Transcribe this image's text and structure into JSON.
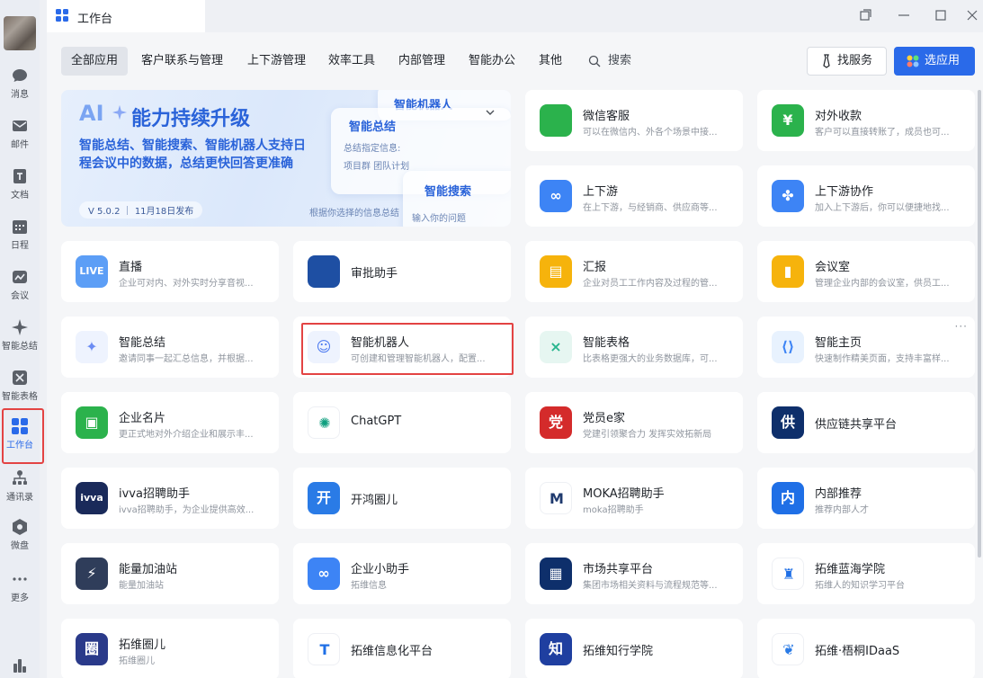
{
  "window": {
    "title": "工作台"
  },
  "sidebar": {
    "items": [
      {
        "label": "消息",
        "icon": "message-icon"
      },
      {
        "label": "邮件",
        "icon": "mail-icon"
      },
      {
        "label": "文档",
        "icon": "document-icon"
      },
      {
        "label": "日程",
        "icon": "calendar-icon"
      },
      {
        "label": "会议",
        "icon": "meeting-icon"
      },
      {
        "label": "智能总结",
        "icon": "sparkle-icon"
      },
      {
        "label": "智能表格",
        "icon": "smart-table-icon"
      },
      {
        "label": "工作台",
        "icon": "workbench-grid-icon",
        "active": true
      },
      {
        "label": "通讯录",
        "icon": "contacts-icon"
      },
      {
        "label": "微盘",
        "icon": "drive-icon"
      },
      {
        "label": "更多",
        "icon": "more-dots-icon"
      }
    ]
  },
  "tabs": [
    "全部应用",
    "客户联系与管理",
    "上下游管理",
    "效率工具",
    "内部管理",
    "智能办公",
    "其他"
  ],
  "search": {
    "label": "搜索"
  },
  "actions": {
    "find_service": "找服务",
    "pick_apps": "选应用"
  },
  "banner": {
    "ai": "AI",
    "title": "能力持续升级",
    "desc": "智能总结、智能搜索、智能机器人支持日程会议中的数据，总结更快回答更准确",
    "version": "V 5.0.2 ｜ 11月18日发布",
    "card1": "智能机器人",
    "card2": "智能总结",
    "card2_sub": "总结指定信息:",
    "card2_chips": "项目群    团队计划",
    "card2_hint": "根据你选择的信息总结",
    "card3": "智能搜索",
    "card3_input": "输入你的问题"
  },
  "apps": [
    {
      "name": "微信客服",
      "desc": "可以在微信内、外各个场景中接...",
      "icon": "wechat-service-icon",
      "color": "#2bb24c"
    },
    {
      "name": "对外收款",
      "desc": "客户可以直接转账了，成员也可...",
      "icon": "payment-icon",
      "color": "#2bb24c"
    },
    {
      "name": "上下游",
      "desc": "在上下游，与经销商、供应商等...",
      "icon": "chain-link-icon",
      "color": "#3d84f5"
    },
    {
      "name": "上下游协作",
      "desc": "加入上下游后，你可以便捷地找...",
      "icon": "grid-petal-icon",
      "color": "#3d84f5"
    },
    {
      "name": "直播",
      "desc": "企业可对内、对外实时分享音视...",
      "icon": "live-icon",
      "color": "#5c9ef6"
    },
    {
      "name": "审批助手",
      "desc": "",
      "icon": "approval-stamp-icon",
      "color": "#1e4fa3"
    },
    {
      "name": "汇报",
      "desc": "企业对员工工作内容及过程的管...",
      "icon": "report-icon",
      "color": "#f6b30c"
    },
    {
      "name": "会议室",
      "desc": "管理企业内部的会议室，供员工...",
      "icon": "meeting-room-icon",
      "color": "#f6b30c"
    },
    {
      "name": "智能总结",
      "desc": "邀请同事一起汇总信息，并根据...",
      "icon": "ai-sparkle-icon",
      "color": "#eef3fe"
    },
    {
      "name": "智能机器人",
      "desc": "可创建和管理智能机器人，配置...",
      "icon": "robot-icon",
      "color": "#eef3fe"
    },
    {
      "name": "智能表格",
      "desc": "比表格更强大的业务数据库，可...",
      "icon": "smart-sheet-icon",
      "color": "#e6f6f1"
    },
    {
      "name": "智能主页",
      "desc": "快速制作精美页面，支持丰富样...",
      "icon": "smart-homepage-icon",
      "color": "#e8f2fe"
    },
    {
      "name": "企业名片",
      "desc": "更正式地对外介绍企业和展示丰...",
      "icon": "business-card-icon",
      "color": "#2bb24c"
    },
    {
      "name": "ChatGPT",
      "desc": "",
      "icon": "chatgpt-icon",
      "color": "#ffffff"
    },
    {
      "name": "党员e家",
      "desc": "党建引领聚合力 发挥实效拓新局",
      "icon": "party-home-icon",
      "color": "#d42b2b"
    },
    {
      "name": "供应链共享平台",
      "desc": "",
      "icon": "supply-chain-icon",
      "color": "#0e2f6b"
    },
    {
      "name": "ivva招聘助手",
      "desc": "ivva招聘助手，为企业提供高效...",
      "icon": "ivva-logo-icon",
      "color": "#1a2a5a"
    },
    {
      "name": "开鸿圈儿",
      "desc": "",
      "icon": "kaihong-icon",
      "color": "#2a7be6"
    },
    {
      "name": "MOKA招聘助手",
      "desc": "moka招聘助手",
      "icon": "moka-logo-icon",
      "color": "#ffffff"
    },
    {
      "name": "内部推荐",
      "desc": "推荐内部人才",
      "icon": "referral-icon",
      "color": "#1f6fe6"
    },
    {
      "name": "能量加油站",
      "desc": "能量加油站",
      "icon": "energy-station-icon",
      "color": "#2f3d5a"
    },
    {
      "name": "企业小助手",
      "desc": "拓维信息",
      "icon": "assistant-infinity-icon",
      "color": "#3d84f5"
    },
    {
      "name": "市场共享平台",
      "desc": "集团市场相关资料与流程规范等...",
      "icon": "market-share-icon",
      "color": "#0e2f6b"
    },
    {
      "name": "拓维蓝海学院",
      "desc": "拓维人的知识学习平台",
      "icon": "blue-ocean-academy-icon",
      "color": "#ffffff"
    },
    {
      "name": "拓维圈儿",
      "desc": "拓维圈儿",
      "icon": "talkweb-circle-icon",
      "color": "#2a3a8a"
    },
    {
      "name": "拓维信息化平台",
      "desc": "",
      "icon": "talkweb-t-icon",
      "color": "#ffffff"
    },
    {
      "name": "拓维知行学院",
      "desc": "",
      "icon": "zhixing-academy-icon",
      "color": "#1f3fa0"
    },
    {
      "name": "拓维·梧桐IDaaS",
      "desc": "",
      "icon": "wutong-idaas-icon",
      "color": "#ffffff"
    }
  ],
  "colors": {
    "accent": "#2a6ae9",
    "highlight": "#e34343",
    "sidebar": "#eaedf3",
    "background": "#f5f6f8"
  }
}
